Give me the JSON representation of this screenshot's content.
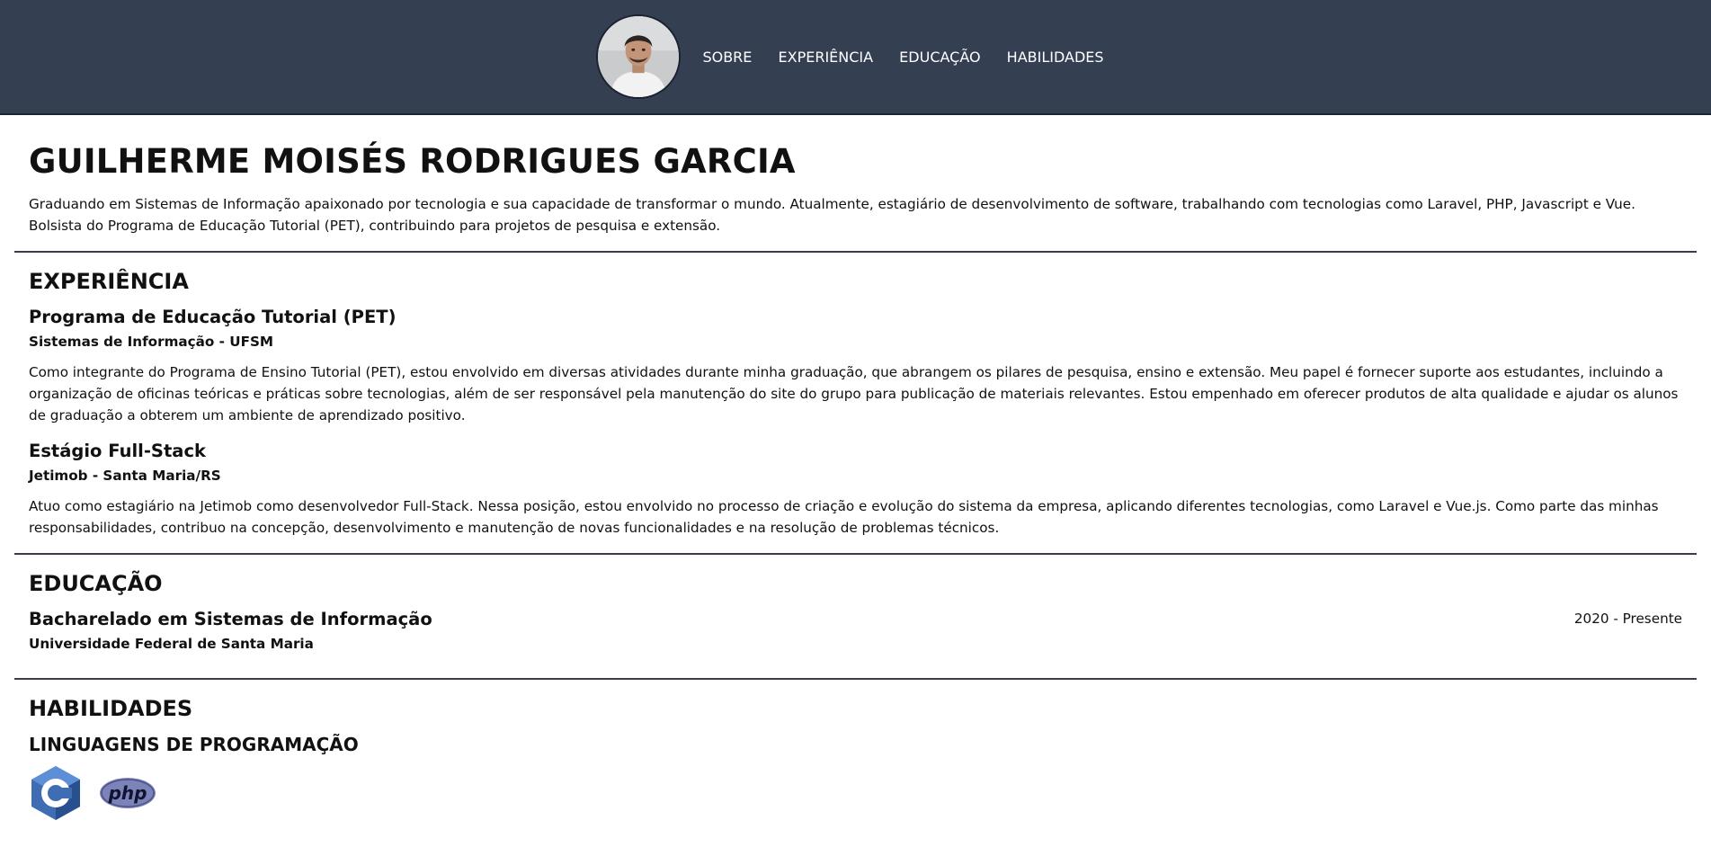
{
  "nav": {
    "avatar_alt": "profile photo",
    "links": [
      "SOBRE",
      "EXPERIÊNCIA",
      "EDUCAÇÃO",
      "HABILIDADES"
    ]
  },
  "about": {
    "name": "GUILHERME MOISÉS RODRIGUES GARCIA",
    "description": "Graduando em Sistemas de Informação apaixonado por tecnologia e sua capacidade de transformar o mundo. Atualmente, estagiário de desenvolvimento de software, trabalhando com tecnologias como Laravel, PHP, Javascript e Vue. Bolsista do Programa de Educação Tutorial (PET), contribuindo para projetos de pesquisa e extensão."
  },
  "experience": {
    "title": "EXPERIÊNCIA",
    "items": [
      {
        "role": "Programa de Educação Tutorial (PET)",
        "org": "Sistemas de Informação - UFSM",
        "text": "Como integrante do Programa de Ensino Tutorial (PET), estou envolvido em diversas atividades durante minha graduação, que abrangem os pilares de pesquisa, ensino e extensão. Meu papel é fornecer suporte aos estudantes, incluindo a organização de oficinas teóricas e práticas sobre tecnologias, além de ser responsável pela manutenção do site do grupo para publicação de materiais relevantes. Estou empenhado em oferecer produtos de alta qualidade e ajudar os alunos de graduação a obterem um ambiente de aprendizado positivo."
      },
      {
        "role": "Estágio Full-Stack",
        "org": "Jetimob - Santa Maria/RS",
        "text": "Atuo como estagiário na Jetimob como desenvolvedor Full-Stack. Nessa posição, estou envolvido no processo de criação e evolução do sistema da empresa, aplicando diferentes tecnologias, como Laravel e Vue.js. Como parte das minhas responsabilidades, contribuo na concepção, desenvolvimento e manutenção de novas funcionalidades e na resolução de problemas técnicos."
      }
    ]
  },
  "education": {
    "title": "EDUCAÇÃO",
    "items": [
      {
        "degree": "Bacharelado em Sistemas de Informação",
        "school": "Universidade Federal de Santa Maria",
        "period": "2020 - Presente"
      }
    ]
  },
  "skills": {
    "title": "HABILIDADES",
    "languages_title": "LINGUAGENS DE PROGRAMAÇÃO",
    "languages": [
      {
        "icon": "c-language-icon",
        "label": "C",
        "color": "#3f6db3"
      },
      {
        "icon": "php-icon",
        "label": "php",
        "color": "#7b83b9"
      }
    ]
  },
  "colors": {
    "header_bg": "#343f52",
    "divider": "#3b3b4d"
  }
}
